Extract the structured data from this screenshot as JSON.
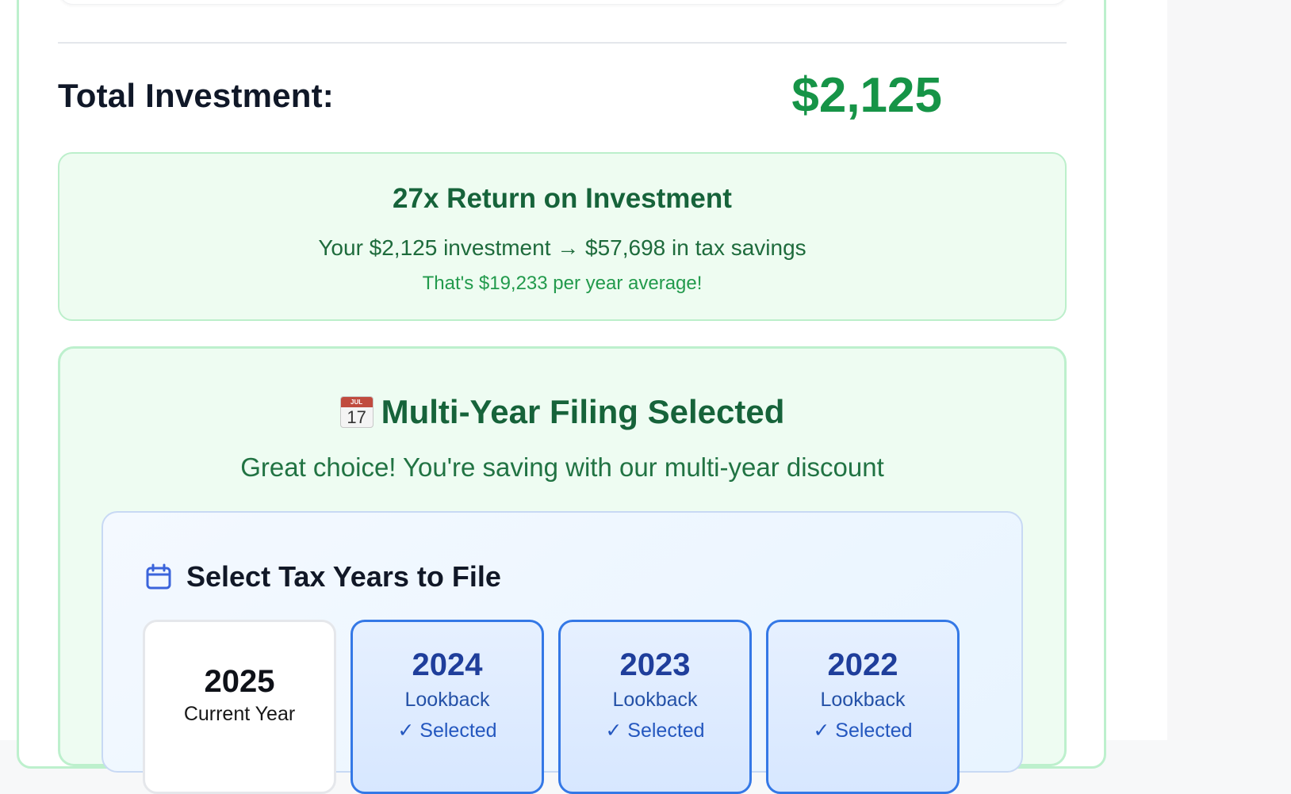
{
  "summary": {
    "total_label": "Total Investment:",
    "total_value": "$2,125"
  },
  "roi": {
    "title": "27x Return on Investment",
    "line": "Your $2,125 investment → $57,698 in tax savings",
    "average": "That's $19,233 per year average!"
  },
  "multi_year": {
    "calendar_month": "JUL",
    "calendar_day": "17",
    "title": "Multi-Year Filing Selected",
    "subtitle": "Great choice! You're saving with our multi-year discount"
  },
  "tax_years": {
    "heading": "Select Tax Years to File",
    "heading_icon": "calendar-icon",
    "cards": [
      {
        "year": "2025",
        "label": "Current Year",
        "status": "",
        "selected": false
      },
      {
        "year": "2024",
        "label": "Lookback",
        "status": "✓ Selected",
        "selected": true
      },
      {
        "year": "2023",
        "label": "Lookback",
        "status": "✓ Selected",
        "selected": true
      },
      {
        "year": "2022",
        "label": "Lookback",
        "status": "✓ Selected",
        "selected": true
      }
    ]
  },
  "colors": {
    "success_green": "#169447",
    "soft_green_background": "#eefcf1",
    "blue_accent": "#3478e6"
  }
}
